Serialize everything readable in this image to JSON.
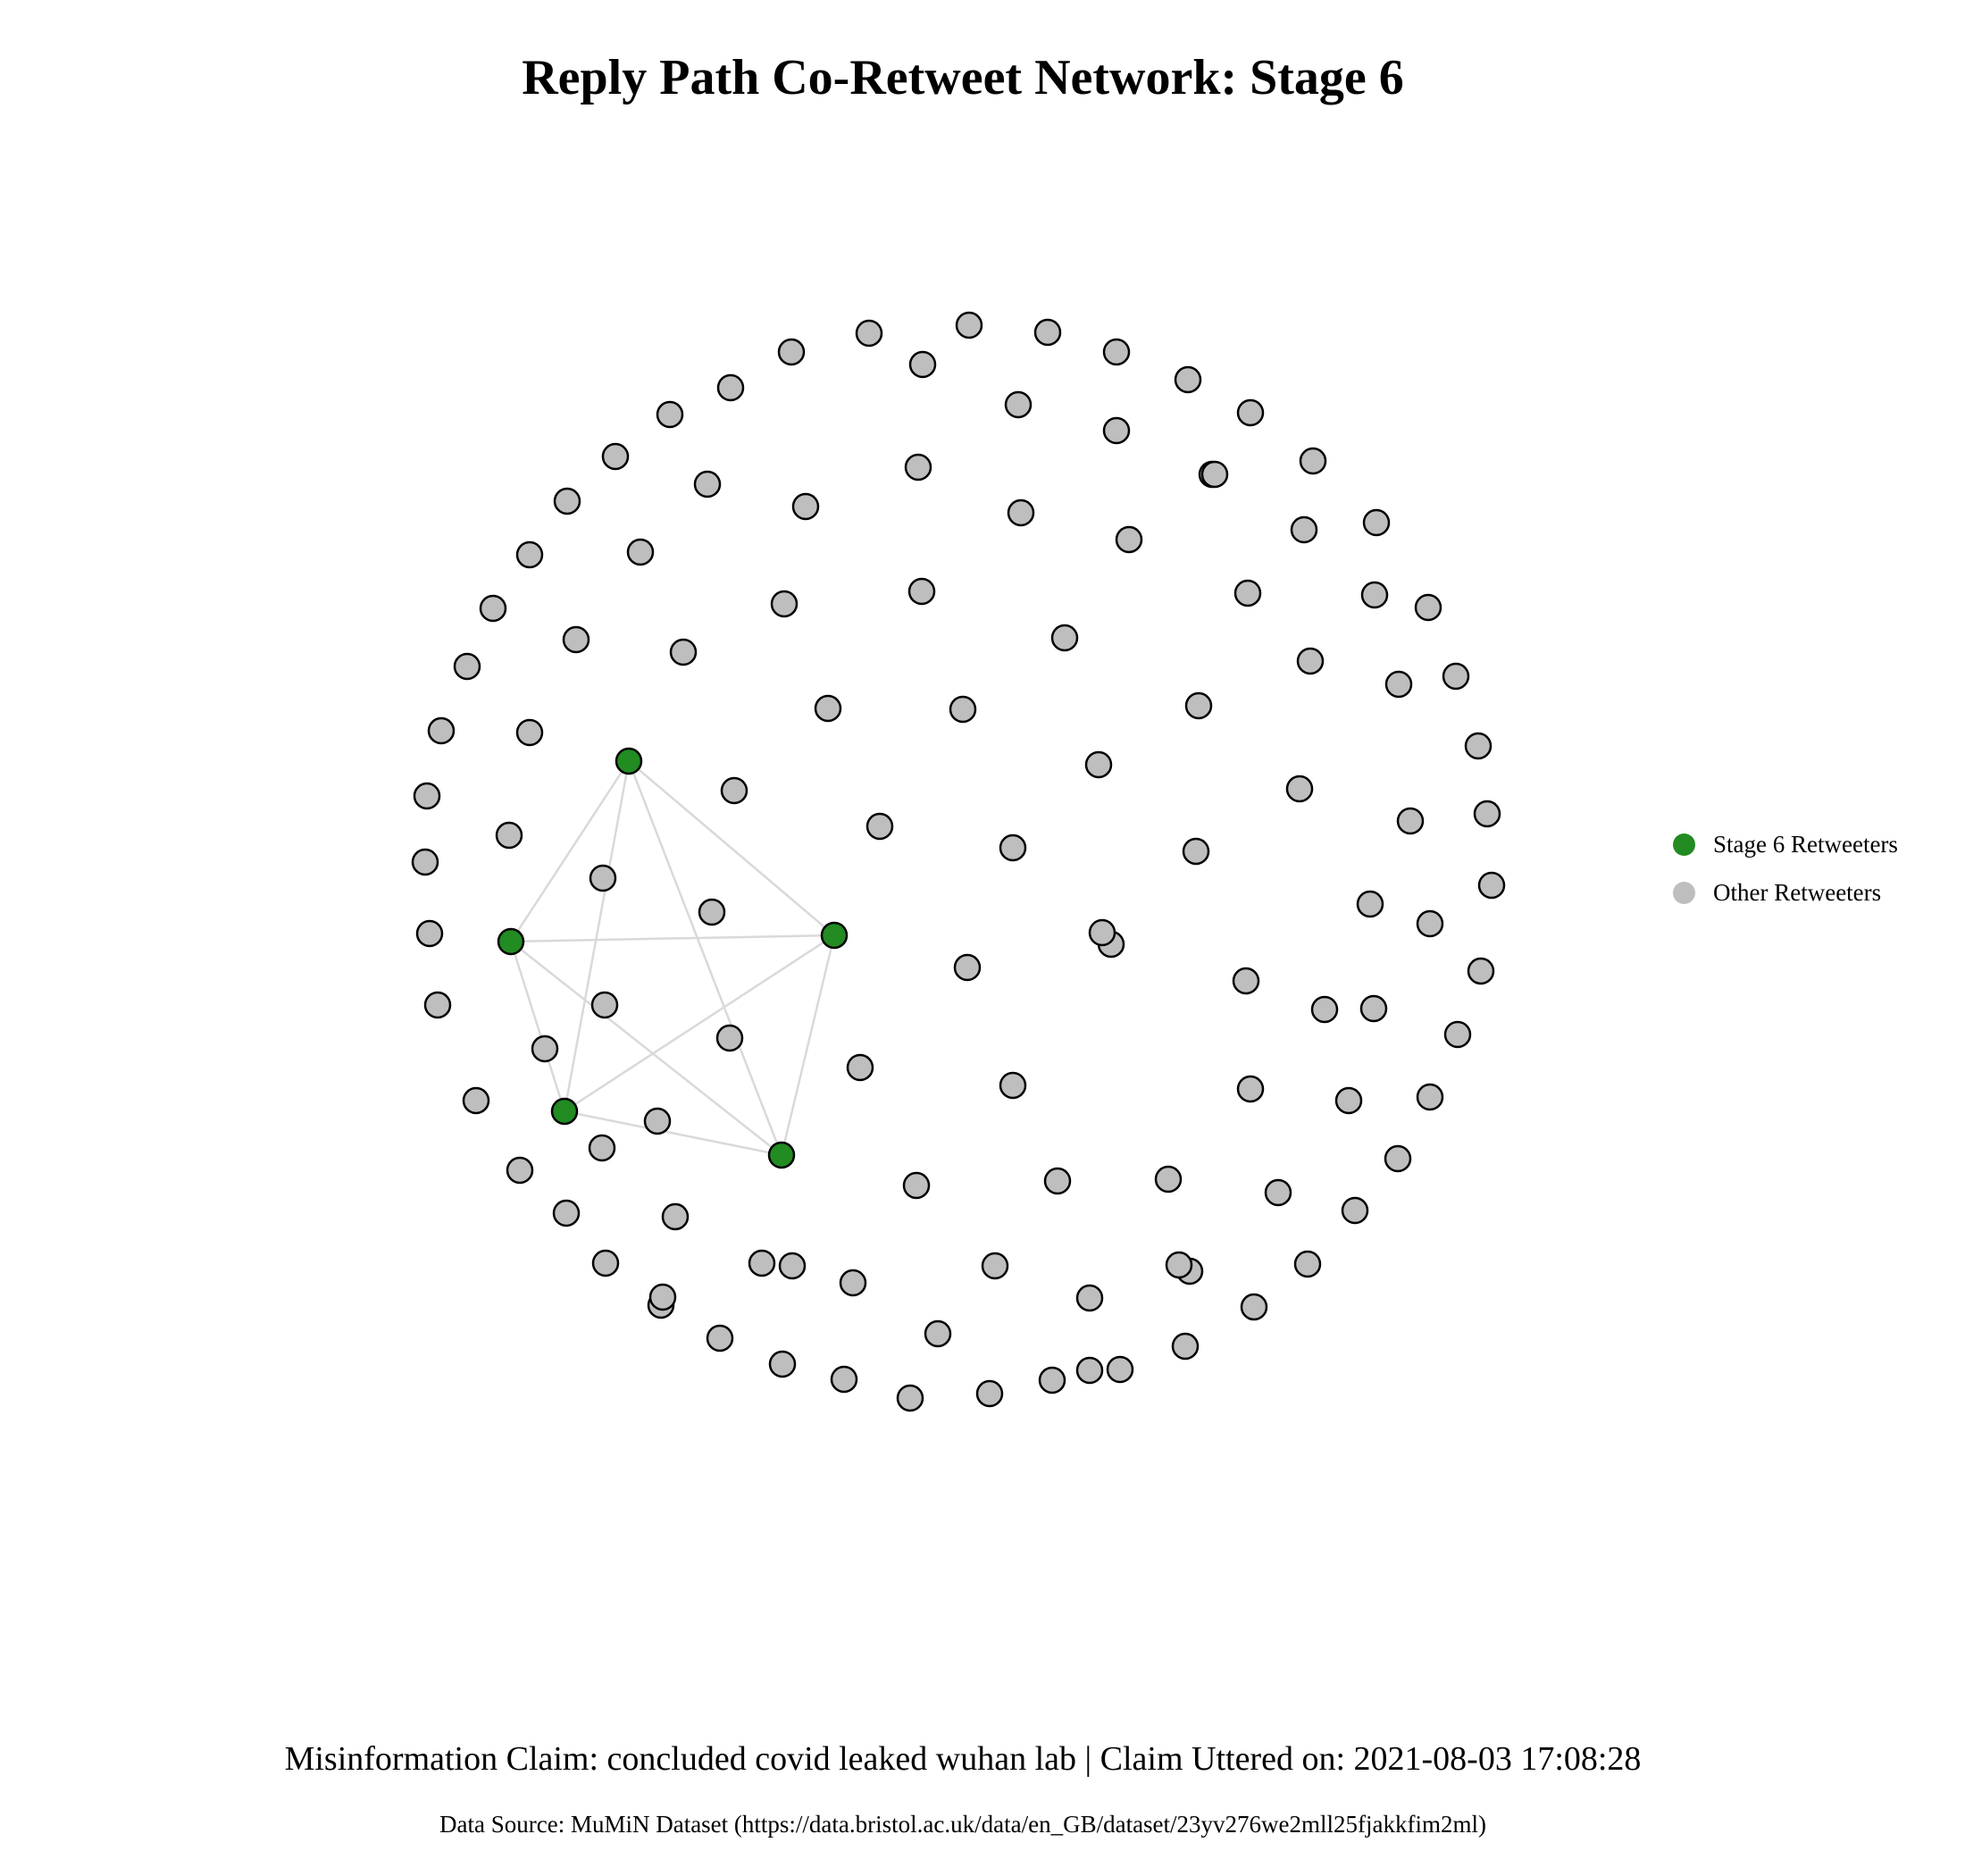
{
  "title": "Reply Path Co-Retweet Network: Stage 6",
  "colors": {
    "stage_node": "#228B22",
    "other_node": "#BEBEBE",
    "node_stroke": "#000000",
    "edge": "#D9D9D9"
  },
  "legend": {
    "stage_label": "Stage 6 Retweeters",
    "other_label": "Other Retweeters"
  },
  "claim_line": "Misinformation Claim: concluded covid leaked wuhan lab | Claim Uttered on: 2021-08-03 17:08:28",
  "source_line": "Data Source: MuMiN Dataset (https://data.bristol.ac.uk/data/en_GB/dataset/23yv276we2mll25fjakkfim2ml)",
  "network": {
    "stage_node_count": 5,
    "other_node_count": 133,
    "edges": "complete graph among the 5 Stage 6 retweeters"
  }
}
